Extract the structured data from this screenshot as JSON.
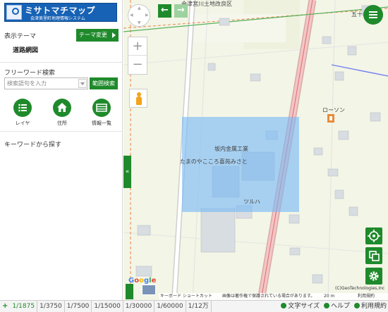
{
  "app": {
    "logo_title": "ミサトマチマップ",
    "logo_subtitle": "会津美里町地理情報システム"
  },
  "sidebar": {
    "theme_label": "表示テーマ",
    "theme_value": "道路網図",
    "theme_change_button": "テーマ変更",
    "freeword_label": "フリーワード検索",
    "search_placeholder": "検索語句を入力",
    "range_search_button": "範囲検索",
    "tools": [
      {
        "label": "レイヤ",
        "icon": "list-icon"
      },
      {
        "label": "住所",
        "icon": "house-icon"
      },
      {
        "label": "情報一覧",
        "icon": "table-icon"
      }
    ],
    "keyword_label": "キーワードから探す"
  },
  "map": {
    "labels": {
      "district_top": "会津宮川土地改良区",
      "top_right": "五十",
      "lawson": "ローソン",
      "factory": "坂内金属工業",
      "nursery": "たまのやこころ喜苑みさと",
      "tsuruha": "ツルハ"
    },
    "colors": {
      "selection": "#78b9f5",
      "accent": "#1f8a2b",
      "main_road": "#f3b5b5"
    },
    "nav": {
      "back_icon": "←",
      "forward_icon": "→"
    },
    "zoom": {
      "in": "+",
      "out": "−"
    },
    "collapse_icon": "«",
    "google_logo": "Google",
    "attribution": {
      "shortcuts": "キーボード ショートカット",
      "copyright_notice": "画像は著作権で保護されている場合があります。",
      "scale": "20 m",
      "terms": "利用規約"
    },
    "copyright": "(C)GeoTechnologies,Inc"
  },
  "bottom": {
    "scale_add": "+",
    "scales": [
      "1/1875",
      "1/3750",
      "1/7500",
      "1/15000",
      "1/30000",
      "1/60000",
      "1/12万"
    ],
    "active_scale_index": 0,
    "links": [
      "文字サイズ",
      "ヘルプ",
      "利用規約"
    ]
  }
}
